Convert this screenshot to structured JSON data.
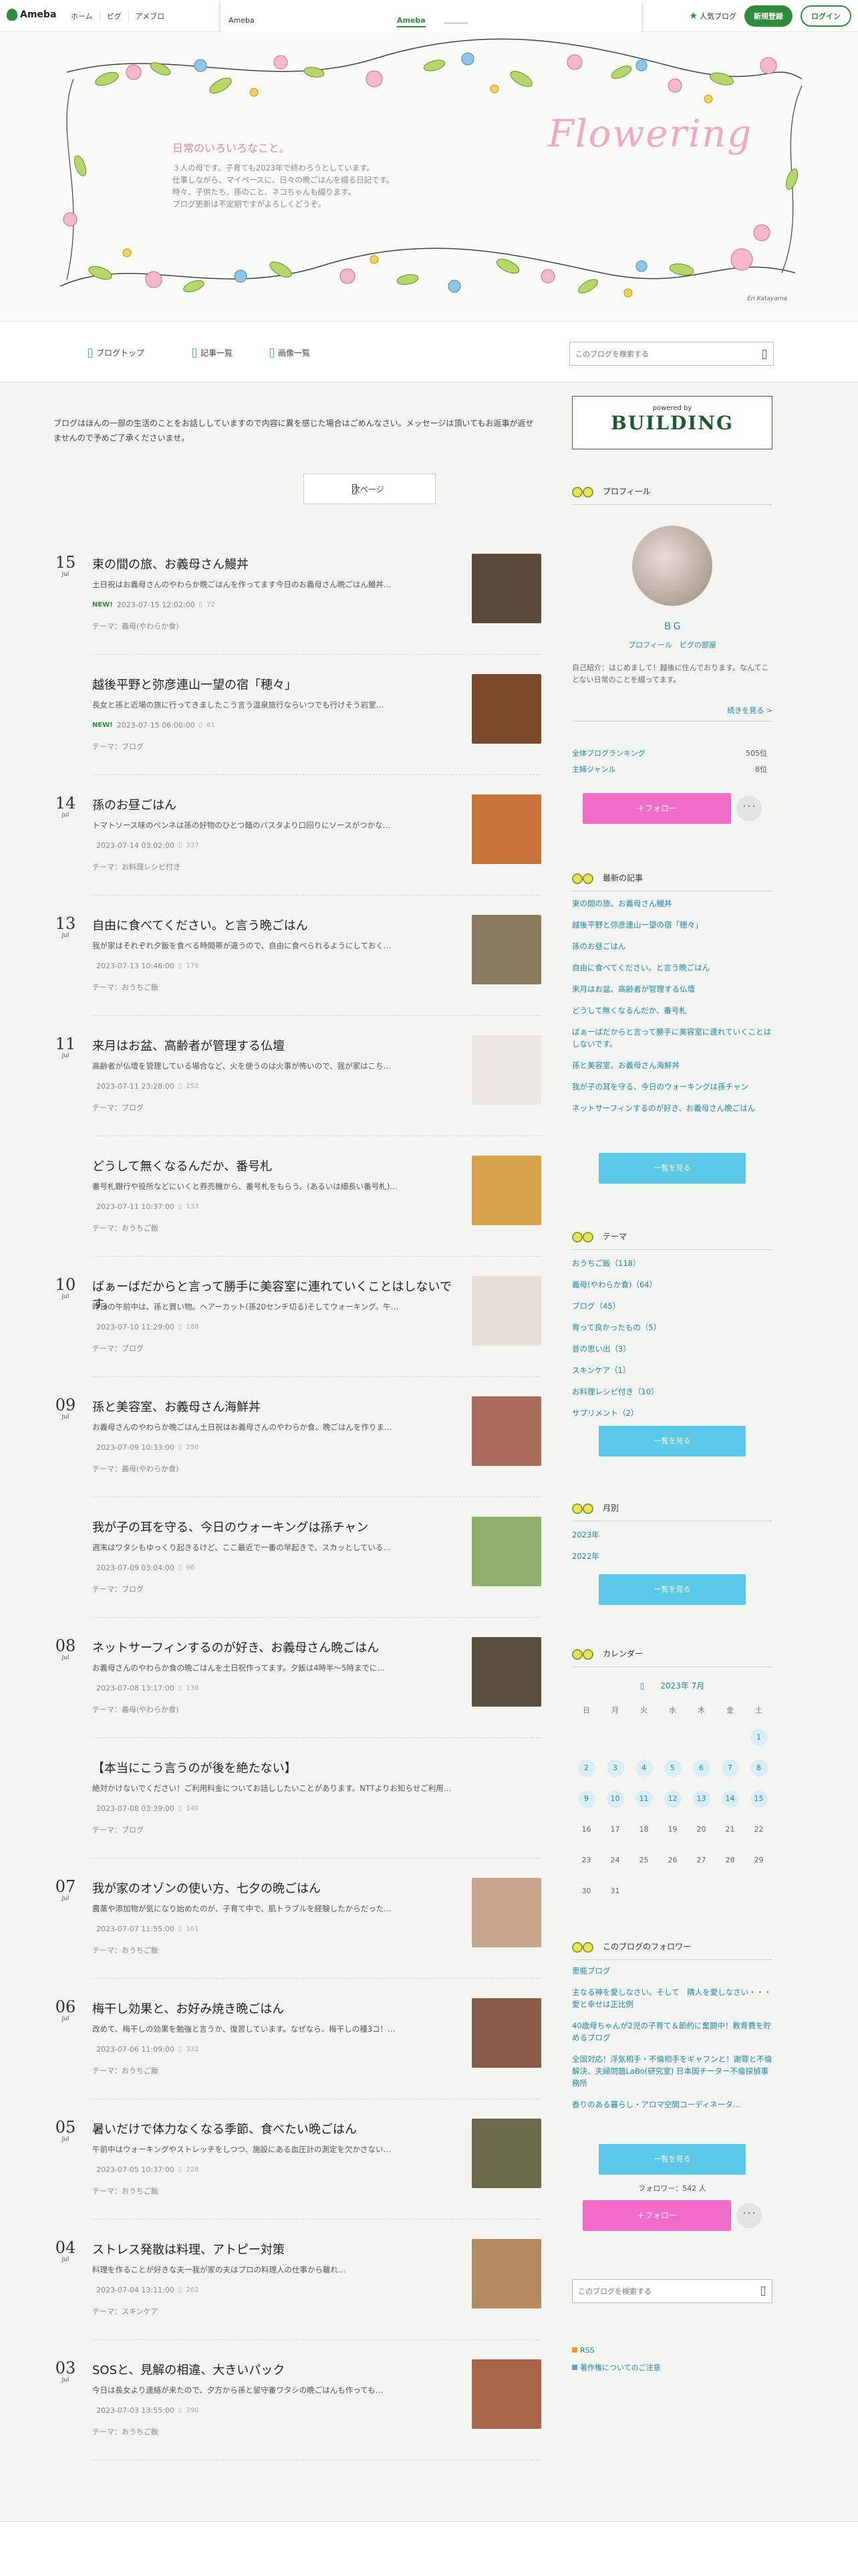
{
  "global_header": {
    "logo": "Ameba",
    "links": [
      "ホーム",
      "ピグ",
      "アメブロ"
    ],
    "popular": "人気ブログ",
    "register": "新規登録",
    "login": "ログイン"
  },
  "ad_bar": {
    "label": "Ameba",
    "link": "Ameba"
  },
  "hero": {
    "title": "日常のいろいろなこと。",
    "intro_lines": [
      "３人の母です。子育ても2023年で終わろうとしています。",
      "仕事しながら、マイペースに、日々の晩ごはんを綴る日記です。",
      "時々、子供たち、孫のこと、ネコちゃんも綴ります。",
      "ブログ更新は不定期ですがよろしくどうぞ。"
    ],
    "script_title": "Flowering",
    "signature": "Eri Katayama"
  },
  "blog_nav": {
    "items": [
      "ブログトップ",
      "記事一覧",
      "画像一覧"
    ],
    "search_placeholder": "このブログを検索する"
  },
  "notice": "ブログはほんの一部の生活のことをお話ししていますので内容に異を感じた場合はごめんなさい。メッセージは頂いてもお返事が返せませんので予めご了承くださいませ。",
  "next_page": "次ページ",
  "entries": [
    {
      "day": "15",
      "month": "Jul",
      "title": "束の間の旅、お義母さん鰻丼",
      "excerpt": "土日祝はお義母さんのやわらか晩ごはんを作ってます今日のお義母さん晩ごはん鰻丼…",
      "new": "NEW!",
      "date": "2023-07-15 12:02:00",
      "comments": "72",
      "theme": "テーマ：義母(やわらか食)",
      "thumb": "#5b4a3c"
    },
    {
      "day": "",
      "month": "",
      "title": "越後平野と弥彦連山一望の宿「穂々」",
      "excerpt": "長女と孫と近場の旅に行ってきましたこう言う温泉旅行ならいつでも行けそう岩室…",
      "new": "NEW!",
      "date": "2023-07-15 06:00:00",
      "comments": "81",
      "theme": "テーマ：ブログ",
      "thumb": "#7a4a2a"
    },
    {
      "day": "14",
      "month": "Jul",
      "title": "孫のお昼ごはん",
      "excerpt": "トマトソース味のペンネは孫の好物のひとつ麺のパスタより口回りにソースがつかな…",
      "new": "",
      "date": "2023-07-14 03:02:00",
      "comments": "337",
      "theme": "テーマ：お料理レシピ付き",
      "thumb": "#c9743a"
    },
    {
      "day": "13",
      "month": "Jul",
      "title": "自由に食べてください。と言う晩ごはん",
      "excerpt": "我が家はそれぞれ夕飯を食べる時間帯が違うので、自由に食べられるようにしておく…",
      "new": "",
      "date": "2023-07-13 10:46:00",
      "comments": "179",
      "theme": "テーマ：おうちご飯",
      "thumb": "#8a7a5e"
    },
    {
      "day": "11",
      "month": "Jul",
      "title": "来月はお盆、高齢者が管理する仏壇",
      "excerpt": "高齢者が仏壇を管理している場合など、火を使うのは火事が怖いので、我が家はこち…",
      "new": "",
      "date": "2023-07-11 23:28:00",
      "comments": "252",
      "theme": "テーマ：ブログ",
      "thumb": "#ece6e2"
    },
    {
      "day": "",
      "month": "",
      "title": "どうして無くなるんだか、番号札",
      "excerpt": "番号札銀行や役所などにいくと券売機から、番号札をもらう。(あるいは細長い番号札)…",
      "new": "",
      "date": "2023-07-11 10:37:00",
      "comments": "133",
      "theme": "テーマ：おうちご飯",
      "thumb": "#d6a24a"
    },
    {
      "day": "10",
      "month": "Jul",
      "title": "ばぁーばだからと言って勝手に美容室に連れていくことはしないです。",
      "excerpt": "昨日の午前中は、孫と買い物。ヘアーカット(孫20センチ切る)そしてウォーキング。午…",
      "new": "",
      "date": "2023-07-10 11:29:00",
      "comments": "188",
      "theme": "テーマ：ブログ",
      "thumb": "#e6ddd5"
    },
    {
      "day": "09",
      "month": "Jul",
      "title": "孫と美容室、お義母さん海鮮丼",
      "excerpt": "お義母さんのやわらか晩ごはん土日祝はお義母さんのやわらか食。晩ごはんを作りま…",
      "new": "",
      "date": "2023-07-09 10:33:00",
      "comments": "250",
      "theme": "テーマ：義母(やわらか食)",
      "thumb": "#a86a5a"
    },
    {
      "day": "",
      "month": "",
      "title": "我が子の耳を守る、今日のウォーキングは孫チャン",
      "excerpt": "週末はワタシもゆっくり起きるけど、ここ最近で一番の早起きで、スカッとしている…",
      "new": "",
      "date": "2023-07-09 03:04:00",
      "comments": "96",
      "theme": "テーマ：ブログ",
      "thumb": "#8fb06a"
    },
    {
      "day": "08",
      "month": "Jul",
      "title": "ネットサーフィンするのが好き、お義母さん晩ごはん",
      "excerpt": "お義母さんのやわらか食の晩ごはんを土日祝作ってます。夕飯は4時半〜5時までに…",
      "new": "",
      "date": "2023-07-08 13:17:00",
      "comments": "139",
      "theme": "テーマ：義母(やわらか食)",
      "thumb": "#5a4e3c"
    },
    {
      "day": "",
      "month": "",
      "title": "【本当にこう言うのが後を絶たない】",
      "excerpt": "絶対かけないでください！ご利用料金についてお話ししたいことがあります。NTTよりお知らせご利用…",
      "new": "",
      "date": "2023-07-08 03:39:00",
      "comments": "140",
      "theme": "テーマ：ブログ",
      "thumb": ""
    },
    {
      "day": "07",
      "month": "Jul",
      "title": "我が家のオゾンの使い方、七夕の晩ごはん",
      "excerpt": "農薬や添加物が気になり始めたのが、子育て中で、肌トラブルを経験したからだった…",
      "new": "",
      "date": "2023-07-07 11:55:00",
      "comments": "161",
      "theme": "テーマ：おうちご飯",
      "thumb": "#c9a58e"
    },
    {
      "day": "06",
      "month": "Jul",
      "title": "梅干し効果と、お好み焼き晩ごはん",
      "excerpt": "改めて、梅干しの効果を勉強と言うか、復習しています。なぜなら、梅干しの種3コ！…",
      "new": "",
      "date": "2023-07-06 11:09:00",
      "comments": "332",
      "theme": "テーマ：おうちご飯",
      "thumb": "#8a5a48"
    },
    {
      "day": "05",
      "month": "Jul",
      "title": "暑いだけで体力なくなる季節、食べたい晩ごはん",
      "excerpt": "午前中はウォーキングやストレッチをしつつ、施設にある血圧計の測定を欠かさない…",
      "new": "",
      "date": "2023-07-05 10:37:00",
      "comments": "228",
      "theme": "テーマ：おうちご飯",
      "thumb": "#6a6a4a"
    },
    {
      "day": "04",
      "month": "Jul",
      "title": "ストレス発散は料理、アトピー対策",
      "excerpt": "料理を作ることが好きな夫一我が家の夫はプロの料理人の仕事から離れ…",
      "new": "",
      "date": "2023-07-04 13:11:00",
      "comments": "262",
      "theme": "テーマ：スキンケア",
      "thumb": "#b58a62"
    },
    {
      "day": "03",
      "month": "Jul",
      "title": "SOSと、見解の相違、大きいパック",
      "excerpt": "今日は長女より連絡が来たので、夕方から孫と留守番ワタシの晩ごはんも作っても…",
      "new": "",
      "date": "2023-07-03 13:55:00",
      "comments": "290",
      "theme": "テーマ：おうちご飯",
      "thumb": "#a8654a"
    }
  ],
  "sidebar": {
    "ad": {
      "small": "powered by",
      "big": "BUILDING"
    },
    "profile": {
      "heading": "プロフィール",
      "name": "ＢＧ",
      "link1": "プロフィール",
      "link2": "ピグの部屋",
      "bio": "自己紹介：はじめまして！越後に住んでおります。なんてことない日常のことを綴ってます。",
      "more": "続きを見る >",
      "rank1_label": "全体ブログランキング",
      "rank1_val": "505位",
      "rank2_label": "主婦ジャンル",
      "rank2_val": "8位",
      "follow": "＋フォロー",
      "more_btn": "･･･"
    },
    "recent": {
      "heading": "最新の記事",
      "items": [
        "束の間の旅、お義母さん鰻丼",
        "越後平野と弥彦連山一望の宿「穂々」",
        "孫のお昼ごはん",
        "自由に食べてください。と言う晩ごはん",
        "来月はお盆、高齢者が管理する仏壇",
        "どうして無くなるんだか、番号札",
        "ばぁーばだからと言って勝手に美容室に連れていくことはしないです。",
        "孫と美容室、お義母さん海鮮丼",
        "我が子の耳を守る、今日のウォーキングは孫チャン",
        "ネットサーフィンするのが好き、お義母さん晩ごはん"
      ],
      "button": "一覧を見る"
    },
    "themes": {
      "heading": "テーマ",
      "items": [
        "おうちご飯（118）",
        "義母(やわらか食)（64）",
        "ブログ（45）",
        "育って良かったもの（5）",
        "昔の思い出（3）",
        "スキンケア（1）",
        "お料理レシピ付き（10）",
        "サプリメント（2）"
      ],
      "button": "一覧を見る"
    },
    "monthly": {
      "heading": "月別",
      "items": [
        "2023年",
        "2022年"
      ],
      "button": "一覧を見る"
    },
    "calendar": {
      "heading": "カレンダー",
      "month": "2023年 7月",
      "dows": [
        "日",
        "月",
        "火",
        "水",
        "木",
        "金",
        "土"
      ],
      "days": [
        "",
        "",
        "",
        "",
        "",
        "",
        "1",
        "2",
        "3",
        "4",
        "5",
        "6",
        "7",
        "8",
        "9",
        "10",
        "11",
        "12",
        "13",
        "14",
        "15",
        "16",
        "17",
        "18",
        "19",
        "20",
        "21",
        "22",
        "23",
        "24",
        "25",
        "26",
        "27",
        "28",
        "29",
        "30",
        "31"
      ],
      "linked": [
        "1",
        "2",
        "3",
        "4",
        "5",
        "6",
        "7",
        "8",
        "9",
        "10",
        "11",
        "12",
        "13",
        "14",
        "15"
      ]
    },
    "followers": {
      "heading": "このブログのフォロワー",
      "items": [
        "恵能ブログ",
        "主なる神を愛しなさい。そして　隣人を愛しなさい・・・　愛と幸せは正比例",
        "40歳母ちゃんが2児の子育て＆節約に奮闘中！教育費を貯めるブログ",
        "全国対応！浮気相手・不倫相手をギャフンと！謝罪と不倫解決、夫婦問題LaBo(研究室) 日本国チーター不倫探偵事務所",
        "香りのある暮らし・アロマ空間コーディネータ…"
      ],
      "button": "一覧を見る",
      "count": "フォロワー：542 人",
      "follow": "＋フォロー",
      "more_btn": "･･･"
    },
    "search_placeholder": "このブログを検索する",
    "rss": "RSS",
    "copyright": "著作権についてのご注意"
  },
  "colors": {
    "accent": "#2d8c3c",
    "link": "#1b8aa8",
    "button": "#5ac8e6",
    "follow": "#f06cc8"
  }
}
